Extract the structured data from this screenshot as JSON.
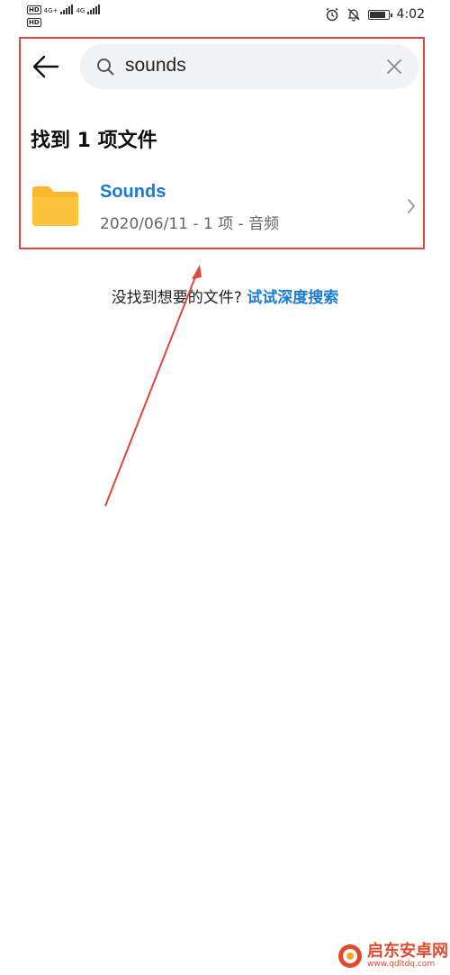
{
  "status_bar": {
    "net_a": "4G+",
    "net_b": "4G",
    "time": "4:02"
  },
  "search": {
    "query": "sounds"
  },
  "results": {
    "count_text": "找到 1 项文件",
    "items": [
      {
        "name": "Sounds",
        "meta": "2020/06/11 - 1 项 - 音频"
      }
    ]
  },
  "deep_search": {
    "prompt": "没找到想要的文件?",
    "link": "试试深度搜索"
  },
  "watermark": {
    "brand": "启东安卓网",
    "url": "www.qdltdq.com"
  },
  "colors": {
    "accent": "#1a7bd6",
    "annotation": "#e0473a",
    "folder": "#fbb82c"
  }
}
